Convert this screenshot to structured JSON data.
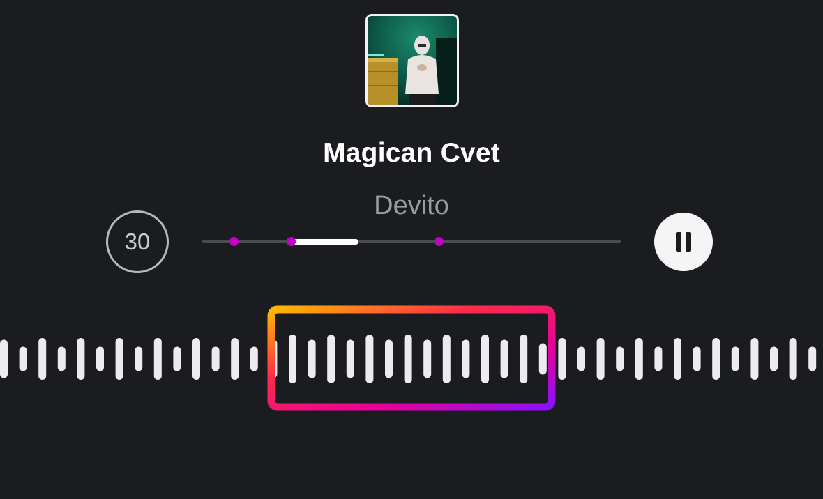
{
  "track": {
    "title": "Magican Cvet",
    "artist": "Devito"
  },
  "controls": {
    "skip_label": "30",
    "pause_icon": "pause-icon"
  },
  "progress": {
    "fill_start_fraction": 0.215,
    "fill_end_fraction": 0.373,
    "marker_fractions": [
      0.075,
      0.212,
      0.565
    ]
  },
  "colors": {
    "background": "#1b1c20",
    "marker": "#c400c8",
    "selection_gradient": [
      "#ffb800",
      "#ff2a4a",
      "#e6009a",
      "#8a10ff"
    ]
  },
  "waveform": {
    "selected_bar_range": [
      14,
      27
    ],
    "bar_levels": [
      0.55,
      0.35,
      0.6,
      0.35,
      0.6,
      0.35,
      0.6,
      0.35,
      0.6,
      0.35,
      0.6,
      0.35,
      0.6,
      0.35,
      0.55,
      0.7,
      0.55,
      0.7,
      0.55,
      0.7,
      0.55,
      0.7,
      0.55,
      0.7,
      0.55,
      0.7,
      0.55,
      0.7,
      0.45,
      0.6,
      0.35,
      0.6,
      0.35,
      0.6,
      0.35,
      0.6,
      0.35,
      0.6,
      0.35,
      0.6,
      0.35,
      0.6,
      0.35
    ]
  }
}
